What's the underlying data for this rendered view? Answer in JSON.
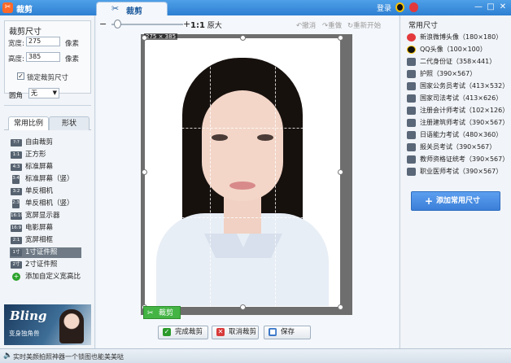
{
  "titlebar": {
    "app_title": "裁剪",
    "tab_label": "裁剪",
    "login_label": "登录",
    "min_glyph": "—",
    "max_glyph": "□",
    "close_glyph": "✕"
  },
  "crop_size": {
    "title": "裁剪尺寸",
    "width_label": "宽度:",
    "width_value": "275",
    "width_unit": "像素",
    "height_label": "高度:",
    "height_value": "385",
    "height_unit": "像素",
    "lock_label": "锁定裁剪尺寸",
    "lock_checked": "✓",
    "round_label": "圆角",
    "round_value": "无"
  },
  "tabs": [
    "常用比例",
    "形状"
  ],
  "ratios": [
    {
      "icon": "?:?",
      "label": "自由裁剪"
    },
    {
      "icon": "1:1",
      "label": "正方形"
    },
    {
      "icon": "4:3",
      "label": "标准屏幕"
    },
    {
      "icon": "3:4",
      "label": "标准屏幕（竖）"
    },
    {
      "icon": "3:2",
      "label": "单反相机"
    },
    {
      "icon": "2:3",
      "label": "单反相机（竖）"
    },
    {
      "icon": "16:10",
      "label": "宽屏显示器"
    },
    {
      "icon": "16:9",
      "label": "电影屏幕"
    },
    {
      "icon": "2:1",
      "label": "宽屏相框"
    },
    {
      "icon": "1寸",
      "label": "1寸证件照"
    },
    {
      "icon": "2寸",
      "label": "2寸证件照"
    },
    {
      "icon": "+",
      "label": "添加自定义宽高比"
    }
  ],
  "ad": {
    "title": "Bling",
    "subtitle": "变身独角兽"
  },
  "toolbar": {
    "zoom_out_glyph": "−",
    "zoom_in_glyph": "+",
    "scale_prefix": "1:1",
    "scale_label": "原大",
    "undo_label": "↶撤消",
    "redo_label": "↷重做",
    "restart_label": "↻重新开始"
  },
  "canvas": {
    "dims_label": "275 × 385",
    "crop_tag": "裁剪",
    "scissors_glyph": "✂"
  },
  "actions": {
    "done_label": "完成裁剪",
    "cancel_label": "取消裁剪",
    "save_label": "保存"
  },
  "right_panel": {
    "title": "常用尺寸",
    "sizes": [
      {
        "icon": "weibo",
        "label": "新浪微博头像（180×180）"
      },
      {
        "icon": "qq",
        "label": "QQ头像（100×100）"
      },
      {
        "icon": "card",
        "label": "二代身份证（358×441）"
      },
      {
        "icon": "card",
        "label": "护照（390×567）"
      },
      {
        "icon": "card",
        "label": "国家公务员考试（413×532）"
      },
      {
        "icon": "card",
        "label": "国家司法考试（413×626）"
      },
      {
        "icon": "card",
        "label": "注册会计师考试（102×126）"
      },
      {
        "icon": "card",
        "label": "注册建筑师考试（390×567）"
      },
      {
        "icon": "card",
        "label": "日语能力考试（480×360）"
      },
      {
        "icon": "card",
        "label": "报关员考试（390×567）"
      },
      {
        "icon": "card",
        "label": "教师资格证统考（390×567）"
      },
      {
        "icon": "card",
        "label": "职业医师考试（390×567）"
      }
    ],
    "add_label": "添加常用尺寸"
  },
  "status": {
    "text": "实时美颜拍照神器一个锁图也能美美哒"
  },
  "colors": {
    "accent": "#2d7fd2",
    "crop_green": "#44b444"
  }
}
